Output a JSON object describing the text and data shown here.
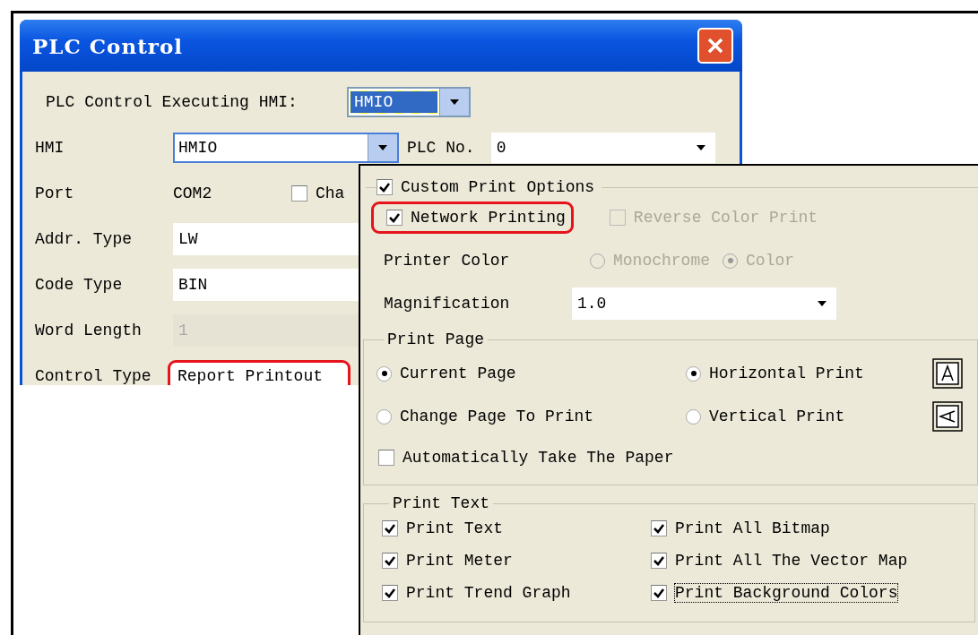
{
  "dialog": {
    "title": "PLC Control"
  },
  "executing_hmi": {
    "label": "PLC Control Executing HMI:",
    "value": "HMIO"
  },
  "hmi": {
    "label": "HMI",
    "value": "HMIO"
  },
  "plc_no": {
    "label": "PLC No.",
    "value": "0"
  },
  "port": {
    "label": "Port",
    "value": "COM2"
  },
  "port_checkbox": {
    "label": "Cha",
    "checked": false
  },
  "fields": [
    {
      "label": "Addr. Type",
      "value": "LW",
      "disabled": false,
      "highlighted": false
    },
    {
      "label": "Code Type",
      "value": "BIN",
      "disabled": false,
      "highlighted": false
    },
    {
      "label": "Word Length",
      "value": "1",
      "disabled": true,
      "highlighted": false
    },
    {
      "label": "Control Type",
      "value": "Report Printout",
      "disabled": false,
      "highlighted": true
    }
  ],
  "print_options": {
    "label": "Custom Print Options",
    "checked": true,
    "network_printing": {
      "label": "Network Printing",
      "checked": true,
      "highlighted": true
    },
    "reverse_color": {
      "label": "Reverse Color Print",
      "checked": false,
      "disabled": true
    },
    "printer_color": {
      "label": "Printer Color",
      "options": [
        {
          "label": "Monochrome",
          "selected": false,
          "disabled": true
        },
        {
          "label": "Color",
          "selected": true,
          "disabled": true
        }
      ]
    },
    "magnification": {
      "label": "Magnification",
      "value": "1.0"
    }
  },
  "print_page": {
    "title": "Print Page",
    "page_options": [
      {
        "label": "Current Page",
        "selected": true
      },
      {
        "label": "Change Page To Print",
        "selected": false
      }
    ],
    "orientation_options": [
      {
        "label": "Horizontal Print",
        "selected": true,
        "kind": "portrait"
      },
      {
        "label": "Vertical Print",
        "selected": false,
        "kind": "landscape"
      }
    ],
    "auto_take_paper": {
      "label": "Automatically Take The Paper",
      "checked": false
    }
  },
  "print_text": {
    "title": "Print Text",
    "items": [
      {
        "label": "Print Text",
        "checked": true,
        "focused": false
      },
      {
        "label": "Print All Bitmap",
        "checked": true,
        "focused": false
      },
      {
        "label": "Print Meter",
        "checked": true,
        "focused": false
      },
      {
        "label": "Print All The Vector Map",
        "checked": true,
        "focused": false
      },
      {
        "label": "Print Trend Graph",
        "checked": true,
        "focused": false
      },
      {
        "label": "Print Background Colors",
        "checked": true,
        "focused": true
      }
    ]
  }
}
